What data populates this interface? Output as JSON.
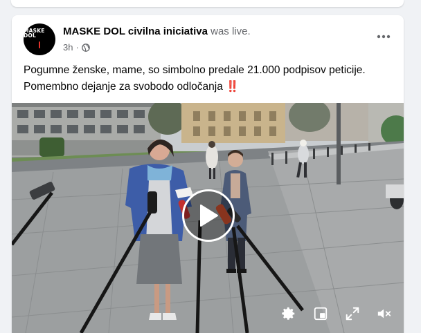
{
  "post": {
    "page_name": "MASKE DOL civilna iniciativa",
    "status_text": "was live.",
    "time": "3h",
    "privacy": "globe-icon",
    "avatar_text": "MASKE DOL",
    "caption": "Pogumne ženske, mame, so simbolno predale 21.000 podpisov peticije. Pomembno dejanje za svobodo odločanja",
    "caption_emoji": "‼️"
  },
  "video": {
    "controls": [
      "settings-icon",
      "miniplayer-icon",
      "fullscreen-icon",
      "mute-icon"
    ]
  },
  "colors": {
    "text_primary": "#050505",
    "text_secondary": "#65676b",
    "background": "#f0f2f5",
    "card": "#ffffff"
  }
}
